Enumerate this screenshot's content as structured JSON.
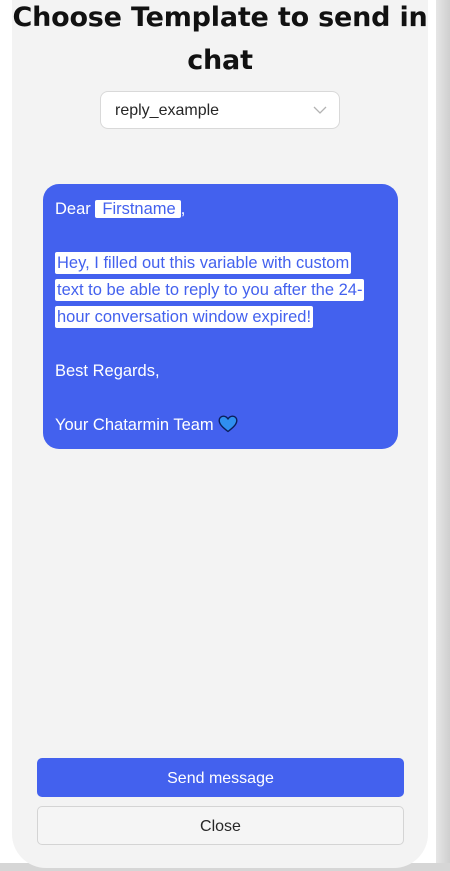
{
  "modal": {
    "title_line1": "Choose Template to send in",
    "title_line2": "chat"
  },
  "template_select": {
    "value": "reply_example",
    "icon": "chevron-down-icon"
  },
  "message": {
    "greeting": "Dear",
    "firstname_variable": "Firstname",
    "greeting_suffix": ",",
    "custom_variable_line1": " Hey, I filled out this variable with custom",
    "custom_variable_line2": "text to be able to reply to you after the 24-",
    "custom_variable_line3": "hour conversation window expired!",
    "closing": "Best Regards,",
    "signature": "Your Chatarmin Team",
    "signature_icon": "blue-heart-icon",
    "bubble_color": "#4361ee"
  },
  "actions": {
    "send_label": "Send message",
    "close_label": "Close",
    "accent_color": "#4361ee"
  }
}
